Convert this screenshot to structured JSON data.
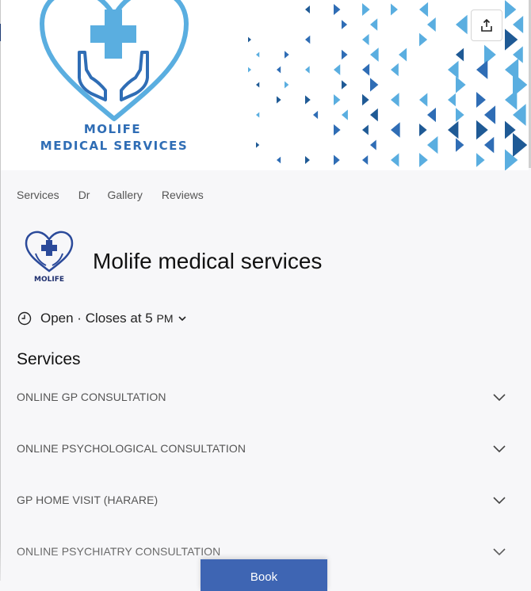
{
  "banner": {
    "brand_line1": "MOLIFE",
    "brand_line2": "MEDICAL SERVICES",
    "colors": {
      "light_blue": "#5aaee0",
      "dark_blue": "#2f6db5",
      "navy": "#1f5a95"
    }
  },
  "share": {
    "icon": "share-upload-icon"
  },
  "tabs": [
    {
      "label": "Services"
    },
    {
      "label": "Dr"
    },
    {
      "label": "Gallery"
    },
    {
      "label": "Reviews"
    }
  ],
  "business": {
    "logo_text": "MOLIFE",
    "title": "Molife medical services"
  },
  "hours": {
    "status": "Open · Closes at 5",
    "suffix": "PM",
    "icon": "clock-icon"
  },
  "services": {
    "heading": "Services",
    "items": [
      {
        "label": "ONLINE GP CONSULTATION"
      },
      {
        "label": "ONLINE PSYCHOLOGICAL CONSULTATION"
      },
      {
        "label": "GP HOME VISIT (HARARE)"
      },
      {
        "label": "ONLINE PSYCHIATRY CONSULTATION"
      }
    ]
  },
  "book": {
    "label": "Book",
    "color": "#3e65b3"
  }
}
